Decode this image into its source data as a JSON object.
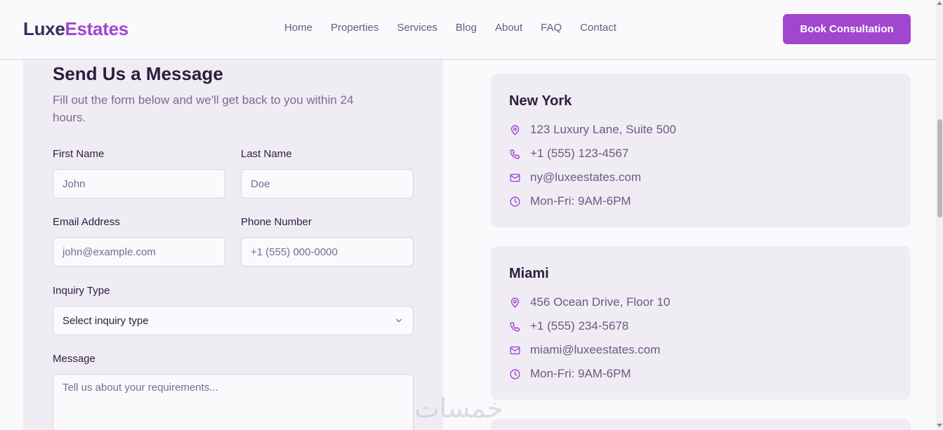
{
  "header": {
    "logo_part1": "Luxe",
    "logo_part2": "Estates",
    "nav": [
      "Home",
      "Properties",
      "Services",
      "Blog",
      "About",
      "FAQ",
      "Contact"
    ],
    "cta_label": "Book Consultation"
  },
  "form": {
    "title": "Send Us a Message",
    "subtitle": "Fill out the form below and we'll get back to you within 24 hours.",
    "first_name": {
      "label": "First Name",
      "placeholder": "John"
    },
    "last_name": {
      "label": "Last Name",
      "placeholder": "Doe"
    },
    "email": {
      "label": "Email Address",
      "placeholder": "john@example.com"
    },
    "phone": {
      "label": "Phone Number",
      "placeholder": "+1 (555) 000-0000"
    },
    "inquiry": {
      "label": "Inquiry Type",
      "value": "Select inquiry type"
    },
    "message": {
      "label": "Message",
      "placeholder": "Tell us about your requirements..."
    }
  },
  "offices": [
    {
      "city": "New York",
      "address": "123 Luxury Lane, Suite 500",
      "phone": "+1 (555) 123-4567",
      "email": "ny@luxeestates.com",
      "hours": "Mon-Fri: 9AM-6PM"
    },
    {
      "city": "Miami",
      "address": "456 Ocean Drive, Floor 10",
      "phone": "+1 (555) 234-5678",
      "email": "miami@luxeestates.com",
      "hours": "Mon-Fri: 9AM-6PM"
    }
  ],
  "watermark": "خمسات",
  "colors": {
    "accent": "#a146cf",
    "dark": "#3d2a5f",
    "panel": "#f0ecf4",
    "muted": "#6b5a82"
  }
}
